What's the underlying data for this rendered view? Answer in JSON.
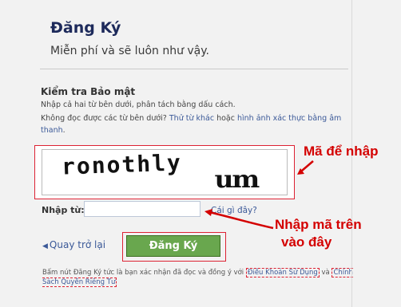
{
  "header": {
    "title": "Đăng Ký",
    "subtitle": "Miễn phí và sẽ luôn như vậy."
  },
  "security": {
    "title": "Kiểm tra Bảo mật",
    "instruction": "Nhập cả hai từ bên dưới, phân tách bằng dấu cách.",
    "cant_read": "Không đọc được các từ bên dưới? ",
    "other_words_link": "Thử từ khác",
    "or": " hoặc ",
    "audio_link": "hình ảnh xác thực bằng âm thanh",
    "period": "."
  },
  "captcha": {
    "word1": "ronothly",
    "word2": "um"
  },
  "form": {
    "input_label": "Nhập từ:",
    "input_value": "",
    "what_link": "Cái gì đây?"
  },
  "actions": {
    "back_label": "Quay trở lại",
    "signup_label": "Đăng Ký"
  },
  "terms": {
    "text_before": "Bấm nút Đăng Ký tức là bạn xác nhận đã đọc và đồng ý với ",
    "terms_link": "Điều Khoản Sử Dụng",
    "and": " và ",
    "privacy_link": "Chính Sách Quyền Riêng Tư"
  },
  "annotations": {
    "captcha_note": "Mã để nhập",
    "input_note_line1": "Nhập mã trên",
    "input_note_line2": "vào đây"
  },
  "colors": {
    "accent": "#3b5998",
    "button": "#69a74e",
    "annotation": "#d40000"
  }
}
